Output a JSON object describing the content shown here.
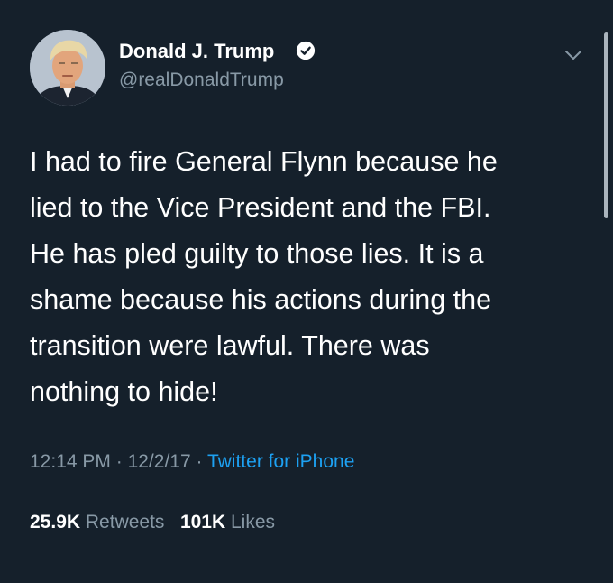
{
  "author": {
    "name": "Donald J. Trump",
    "handle": "@realDonaldTrump",
    "verified": true
  },
  "tweet": {
    "lines": [
      "I had to fire General Flynn because he",
      "lied to the Vice President and the FBI.",
      "He has pled guilty to those lies. It is a",
      "shame because his actions during the",
      "transition were lawful. There was",
      "nothing to hide!"
    ],
    "time": "12:14 PM",
    "date": "12/2/17",
    "separator": "·",
    "source": "Twitter for iPhone"
  },
  "stats": {
    "retweets_count": "25.9K",
    "retweets_label": "Retweets",
    "likes_count": "101K",
    "likes_label": "Likes"
  },
  "colors": {
    "background": "#15202b",
    "text_primary": "#ffffff",
    "text_secondary": "#8899a6",
    "link": "#1da1f2",
    "divider": "#38444d"
  },
  "icons": {
    "verified": "verified-badge-icon",
    "more": "chevron-down-icon"
  }
}
